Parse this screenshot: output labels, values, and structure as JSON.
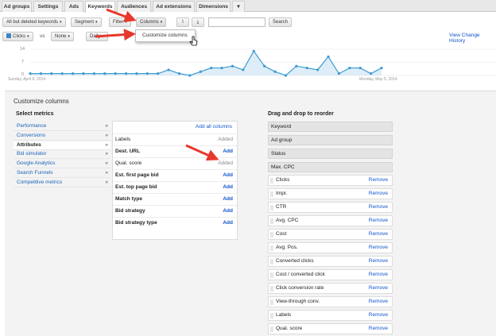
{
  "tabs": [
    "Ad groups",
    "Settings",
    "Ads",
    "Keywords",
    "Audiences",
    "Ad extensions",
    "Dimensions"
  ],
  "toolbar": {
    "filter_select": "All but deleted keywords",
    "segment": "Segment",
    "filter": "Filter",
    "columns": "Columns",
    "search_button": "Search",
    "search_value": ""
  },
  "dropdown": {
    "item": "Customize columns"
  },
  "chart_controls": {
    "metric1": "Clicks",
    "vs": "vs",
    "metric2": "None",
    "period": "Daily",
    "view_history": "View Change History"
  },
  "chart_data": {
    "type": "area",
    "y_ticks": [
      "14",
      "7",
      "0"
    ],
    "start_date": "Sunday, April 6, 2014",
    "end_date": "Monday, May 5, 2014",
    "values": [
      1,
      1,
      1,
      1,
      1,
      1,
      1,
      1,
      1,
      1,
      1,
      1,
      1,
      3,
      1,
      0,
      2,
      4,
      4,
      5,
      3,
      13,
      5,
      2,
      0,
      5,
      4,
      3,
      10,
      1,
      4,
      4,
      1,
      4
    ]
  },
  "panel": {
    "title": "Customize columns",
    "select_metrics": "Select metrics",
    "reorder_title": "Drag and drop to reorder",
    "add_all": "Add all columns",
    "categories": [
      "Performance",
      "Conversions",
      "Attributes",
      "Bid simulator",
      "Google Analytics",
      "Search Funnels",
      "Competitive metrics"
    ],
    "selected_category": "Attributes",
    "metrics": [
      {
        "label": "Labels",
        "action": "Added",
        "bold": false
      },
      {
        "label": "Dest. URL",
        "action": "Add",
        "bold": true
      },
      {
        "label": "Qual. score",
        "action": "Added",
        "bold": false
      },
      {
        "label": "Est. first page bid",
        "action": "Add",
        "bold": true
      },
      {
        "label": "Est. top page bid",
        "action": "Add",
        "bold": true
      },
      {
        "label": "Match type",
        "action": "Add",
        "bold": true
      },
      {
        "label": "Bid strategy",
        "action": "Add",
        "bold": true
      },
      {
        "label": "Bid strategy type",
        "action": "Add",
        "bold": true
      }
    ],
    "fixed_columns": [
      "Keyword",
      "Ad group",
      "Status",
      "Max. CPC"
    ],
    "draggable_columns": [
      "Clicks",
      "Impr.",
      "CTR",
      "Avg. CPC",
      "Cost",
      "Avg. Pos.",
      "Converted clicks",
      "Cost / converted click",
      "Click conversion rate",
      "View-through conv.",
      "Labels",
      "Qual. score"
    ],
    "remove_label": "Remove"
  },
  "colors": {
    "link": "#1155cc",
    "series": "#3d9bd1",
    "arrow": "#e8372c"
  }
}
